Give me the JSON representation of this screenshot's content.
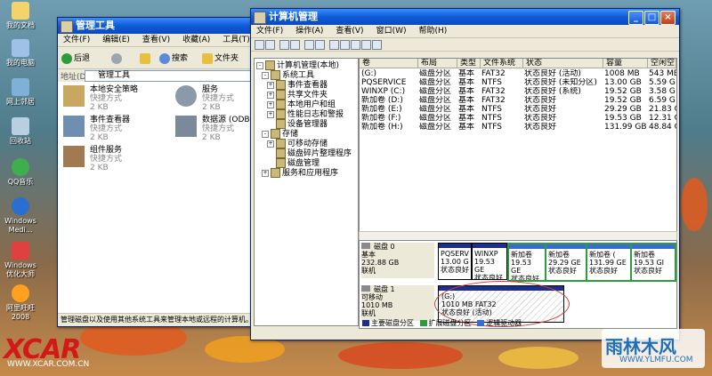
{
  "desktop": {
    "icons": [
      {
        "label": "我的文档"
      },
      {
        "label": "我的电脑"
      },
      {
        "label": "网上邻居"
      },
      {
        "label": "回收站"
      },
      {
        "label": "QQ音乐"
      },
      {
        "label": "Windows Medi..."
      },
      {
        "label": "Windows 优化大师"
      },
      {
        "label": "阿里旺旺 2008"
      }
    ],
    "watermark_left": "XCAR",
    "watermark_left_url": "WWW.XCAR.COM.CN",
    "watermark_right": "雨林木风",
    "watermark_right_url": "WWW.YLMFU.COM"
  },
  "admin_tools": {
    "title": "管理工具",
    "menu": [
      "文件(F)",
      "编辑(E)",
      "查看(V)",
      "收藏(A)",
      "工具(T)"
    ],
    "back_label": "后退",
    "search_label": "搜索",
    "folders_label": "文件夹",
    "address_label": "地址(D)",
    "address_value": "管理工具",
    "items": [
      {
        "name": "本地安全策略",
        "type": "快捷方式",
        "size": "2 KB"
      },
      {
        "name": "服务",
        "type": "快捷方式",
        "size": "2 KB"
      },
      {
        "name": "事件查看器",
        "type": "快捷方式",
        "size": "2 KB"
      },
      {
        "name": "数据源 (ODBC)",
        "type": "快捷方式",
        "size": "2 KB"
      },
      {
        "name": "组件服务",
        "type": "快捷方式",
        "size": "2 KB"
      }
    ],
    "status": "管理磁盘以及使用其他系统工具来管理本地或远程的计算机。"
  },
  "computer_mgmt": {
    "title": "计算机管理",
    "menu": [
      "文件(F)",
      "操作(A)",
      "查看(V)",
      "窗口(W)",
      "帮助(H)"
    ],
    "tree": [
      {
        "label": "计算机管理(本地)",
        "level": 0,
        "expander": "-"
      },
      {
        "label": "系统工具",
        "level": 1,
        "expander": "-"
      },
      {
        "label": "事件查看器",
        "level": 2,
        "expander": "+"
      },
      {
        "label": "共享文件夹",
        "level": 2,
        "expander": "+"
      },
      {
        "label": "本地用户和组",
        "level": 2,
        "expander": "+"
      },
      {
        "label": "性能日志和警报",
        "level": 2,
        "expander": "+"
      },
      {
        "label": "设备管理器",
        "level": 2,
        "expander": ""
      },
      {
        "label": "存储",
        "level": 1,
        "expander": "-"
      },
      {
        "label": "可移动存储",
        "level": 2,
        "expander": "+"
      },
      {
        "label": "磁盘碎片整理程序",
        "level": 2,
        "expander": ""
      },
      {
        "label": "磁盘管理",
        "level": 2,
        "expander": ""
      },
      {
        "label": "服务和应用程序",
        "level": 1,
        "expander": "+"
      }
    ],
    "columns": [
      "卷",
      "布局",
      "类型",
      "文件系统",
      "状态",
      "容量",
      "空闲空"
    ],
    "volumes": [
      {
        "vol": "(G:)",
        "layout": "磁盘分区",
        "type": "基本",
        "fs": "FAT32",
        "status": "状态良好 (活动)",
        "cap": "1008 MB",
        "free": "543 MB"
      },
      {
        "vol": "PQSERVICE",
        "layout": "磁盘分区",
        "type": "基本",
        "fs": "NTFS",
        "status": "状态良好 (未知分区)",
        "cap": "13.00 GB",
        "free": "5.59 G"
      },
      {
        "vol": "WINXP (C:)",
        "layout": "磁盘分区",
        "type": "基本",
        "fs": "FAT32",
        "status": "状态良好 (系统)",
        "cap": "19.52 GB",
        "free": "3.58 G"
      },
      {
        "vol": "新加卷 (D:)",
        "layout": "磁盘分区",
        "type": "基本",
        "fs": "FAT32",
        "status": "状态良好",
        "cap": "19.52 GB",
        "free": "6.59 G"
      },
      {
        "vol": "新加卷 (E:)",
        "layout": "磁盘分区",
        "type": "基本",
        "fs": "NTFS",
        "status": "状态良好",
        "cap": "29.29 GB",
        "free": "21.83 G"
      },
      {
        "vol": "新加卷 (F:)",
        "layout": "磁盘分区",
        "type": "基本",
        "fs": "NTFS",
        "status": "状态良好",
        "cap": "19.53 GB",
        "free": "12.31 G"
      },
      {
        "vol": "新加卷 (H:)",
        "layout": "磁盘分区",
        "type": "基本",
        "fs": "NTFS",
        "status": "状态良好",
        "cap": "131.99 GB",
        "free": "48.84 G"
      }
    ],
    "disk0": {
      "name": "磁盘 0",
      "kind": "基本",
      "size": "232.88 GB",
      "state": "联机",
      "parts": [
        {
          "name": "PQSERV",
          "size": "13.00 G",
          "state": "状态良好"
        },
        {
          "name": "WINXP",
          "size": "19.53 GE",
          "state": "状态良好"
        },
        {
          "name": "新加卷",
          "size": "19.53 GE",
          "state": "状态良好"
        },
        {
          "name": "新加卷",
          "size": "29.29 GE",
          "state": "状态良好"
        },
        {
          "name": "新加卷 (",
          "size": "131.99 GE",
          "state": "状态良好"
        },
        {
          "name": "新加卷",
          "size": "19.53 GI",
          "state": "状态良好"
        }
      ]
    },
    "disk1": {
      "name": "磁盘 1",
      "kind": "可移动",
      "size": "1010 MB",
      "state": "联机",
      "part_name": "(G:)",
      "part_size": "1010 MB FAT32",
      "part_state": "状态良好 (活动)"
    },
    "legend": [
      "主要磁盘分区",
      "扩展磁盘分区",
      "逻辑驱动器"
    ]
  }
}
